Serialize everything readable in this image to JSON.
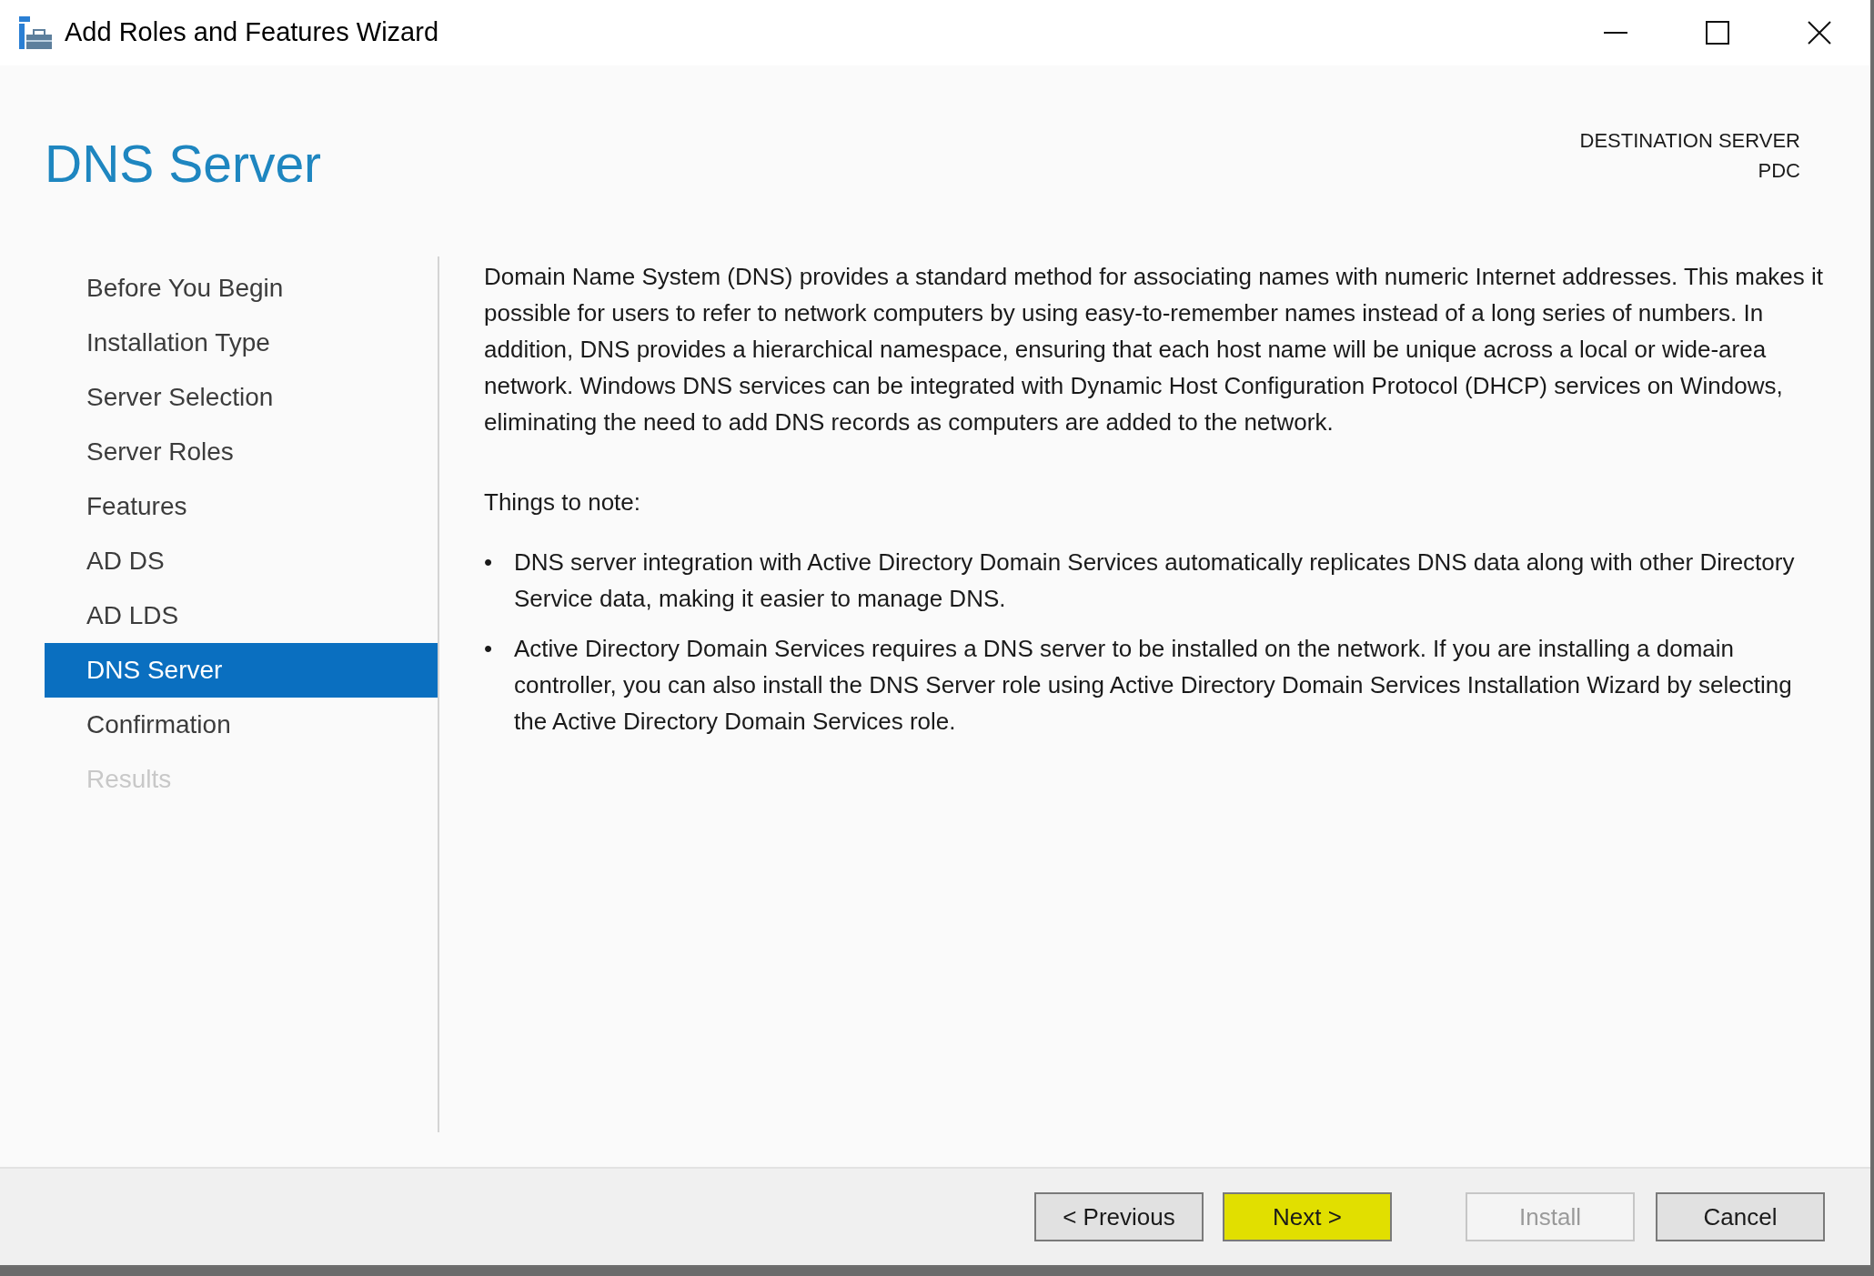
{
  "window": {
    "title": "Add Roles and Features Wizard"
  },
  "page_title": "DNS Server",
  "destination_server": {
    "label": "DESTINATION SERVER",
    "name": "PDC"
  },
  "steps": [
    {
      "label": "Before You Begin",
      "selected": false,
      "disabled": false
    },
    {
      "label": "Installation Type",
      "selected": false,
      "disabled": false
    },
    {
      "label": "Server Selection",
      "selected": false,
      "disabled": false
    },
    {
      "label": "Server Roles",
      "selected": false,
      "disabled": false
    },
    {
      "label": "Features",
      "selected": false,
      "disabled": false
    },
    {
      "label": "AD DS",
      "selected": false,
      "disabled": false
    },
    {
      "label": "AD LDS",
      "selected": false,
      "disabled": false
    },
    {
      "label": "DNS Server",
      "selected": true,
      "disabled": false
    },
    {
      "label": "Confirmation",
      "selected": false,
      "disabled": false
    },
    {
      "label": "Results",
      "selected": false,
      "disabled": true
    }
  ],
  "description": "Domain Name System (DNS) provides a standard method for associating names with numeric Internet addresses. This makes it possible for users to refer to network computers by using easy-to-remember names instead of a long series of numbers. In addition, DNS provides a hierarchical namespace, ensuring that each host name will be unique across a local or wide-area network. Windows DNS services can be integrated with Dynamic Host Configuration Protocol (DHCP) services on Windows, eliminating the need to add DNS records as computers are added to the network.",
  "notes_heading": "Things to note:",
  "notes": [
    {
      "bullet": "•",
      "text": "DNS server integration with Active Directory Domain Services automatically replicates DNS data along with other Directory Service data, making it easier to manage DNS."
    },
    {
      "bullet": "•",
      "text": "Active Directory Domain Services requires a DNS server to be installed on the network. If you are installing a domain controller, you can also install the DNS Server role using Active Directory Domain Services Installation Wizard by selecting the Active Directory Domain Services role."
    }
  ],
  "buttons": [
    {
      "label": "< Previous",
      "disabled": false,
      "highlighted": false
    },
    {
      "label": "Next >",
      "disabled": false,
      "highlighted": true
    },
    {
      "label": "Install",
      "disabled": true,
      "highlighted": false
    },
    {
      "label": "Cancel",
      "disabled": false,
      "highlighted": false
    }
  ]
}
